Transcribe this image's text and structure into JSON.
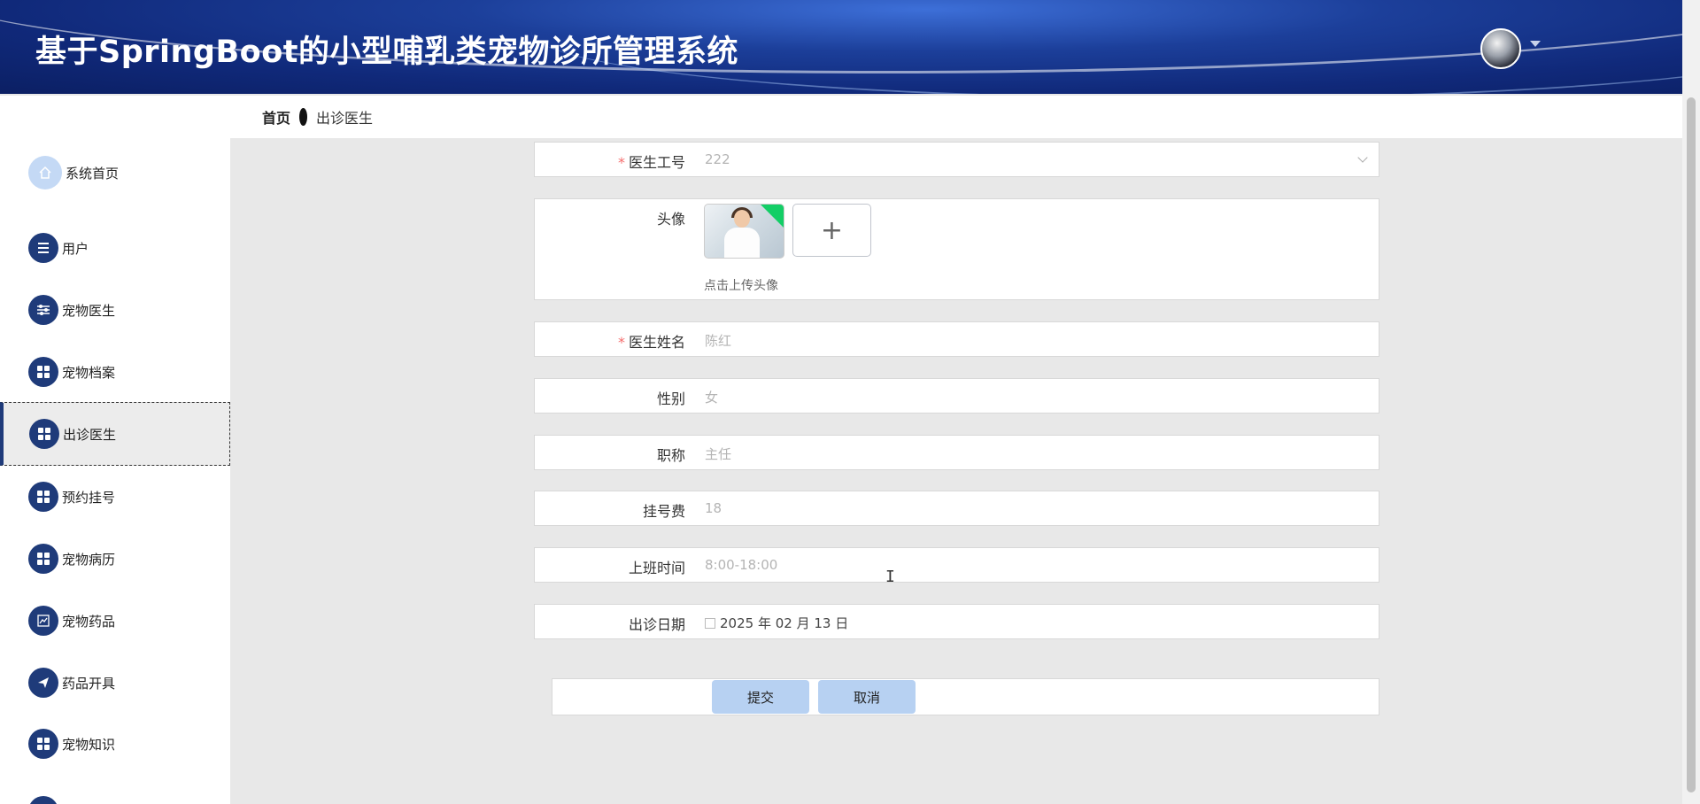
{
  "header": {
    "title": "基于SpringBoot的小型哺乳类宠物诊所管理系统"
  },
  "breadcrumb": {
    "home": "首页",
    "current": "出诊医生"
  },
  "sidebar": {
    "items": [
      {
        "label": "系统首页",
        "icon": "home-icon"
      },
      {
        "label": "用户",
        "icon": "list-icon"
      },
      {
        "label": "宠物医生",
        "icon": "sliders-icon"
      },
      {
        "label": "宠物档案",
        "icon": "grid-icon"
      },
      {
        "label": "出诊医生",
        "icon": "grid-icon",
        "active": true
      },
      {
        "label": "预约挂号",
        "icon": "grid-icon"
      },
      {
        "label": "宠物病历",
        "icon": "grid-icon"
      },
      {
        "label": "宠物药品",
        "icon": "chart-icon"
      },
      {
        "label": "药品开具",
        "icon": "send-icon"
      },
      {
        "label": "宠物知识",
        "icon": "grid-icon"
      }
    ]
  },
  "form": {
    "doctor_id": {
      "label": "医生工号",
      "value": "222",
      "required": true
    },
    "avatar": {
      "label": "头像",
      "tip": "点击上传头像",
      "add_symbol": "+"
    },
    "doctor_name": {
      "label": "医生姓名",
      "value": "陈红",
      "required": true
    },
    "gender": {
      "label": "性别",
      "value": "女"
    },
    "title": {
      "label": "职称",
      "value": "主任"
    },
    "fee": {
      "label": "挂号费",
      "value": "18"
    },
    "work_time": {
      "label": "上班时间",
      "value": "8:00-18:00"
    },
    "visit_date": {
      "label": "出诊日期",
      "value": "2025 年 02 月 13 日"
    },
    "required_mark": "*",
    "submit_label": "提交",
    "cancel_label": "取消"
  },
  "colors": {
    "primary": "#1f3b7a",
    "button": "#b7d1f2",
    "required": "#f56c6c"
  }
}
